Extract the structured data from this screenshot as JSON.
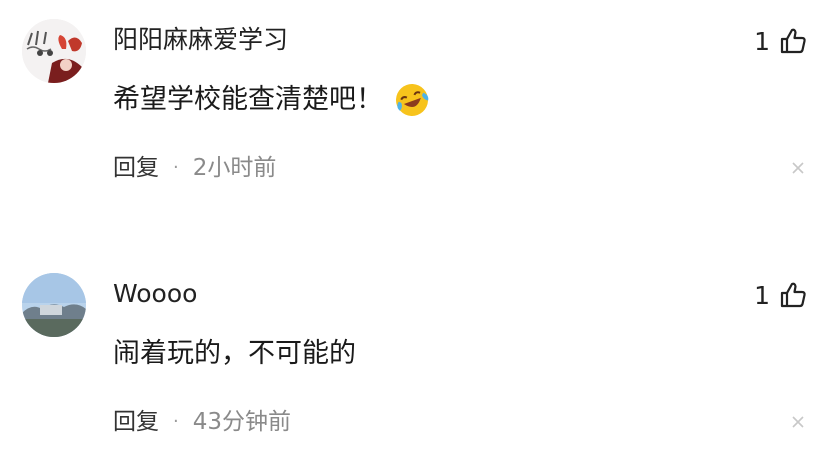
{
  "comments": [
    {
      "username": "阳阳麻麻爱学习",
      "avatar_icon": "cartoon-girl-avatar-icon",
      "text": "希望学校能查清楚吧！",
      "emoji_icon": "laughing-crying-emoji-icon",
      "likes": "1",
      "reply_label": "回复",
      "separator": "·",
      "time": "2小时前"
    },
    {
      "username": "Woooo",
      "avatar_icon": "landscape-photo-avatar-icon",
      "text": "闹着玩的，不可能的",
      "likes": "1",
      "reply_label": "回复",
      "separator": "·",
      "time": "43分钟前"
    }
  ],
  "colors": {
    "text_primary": "#1a1a1a",
    "text_meta": "#8a8a8a",
    "dismiss": "#c8c8c8"
  }
}
